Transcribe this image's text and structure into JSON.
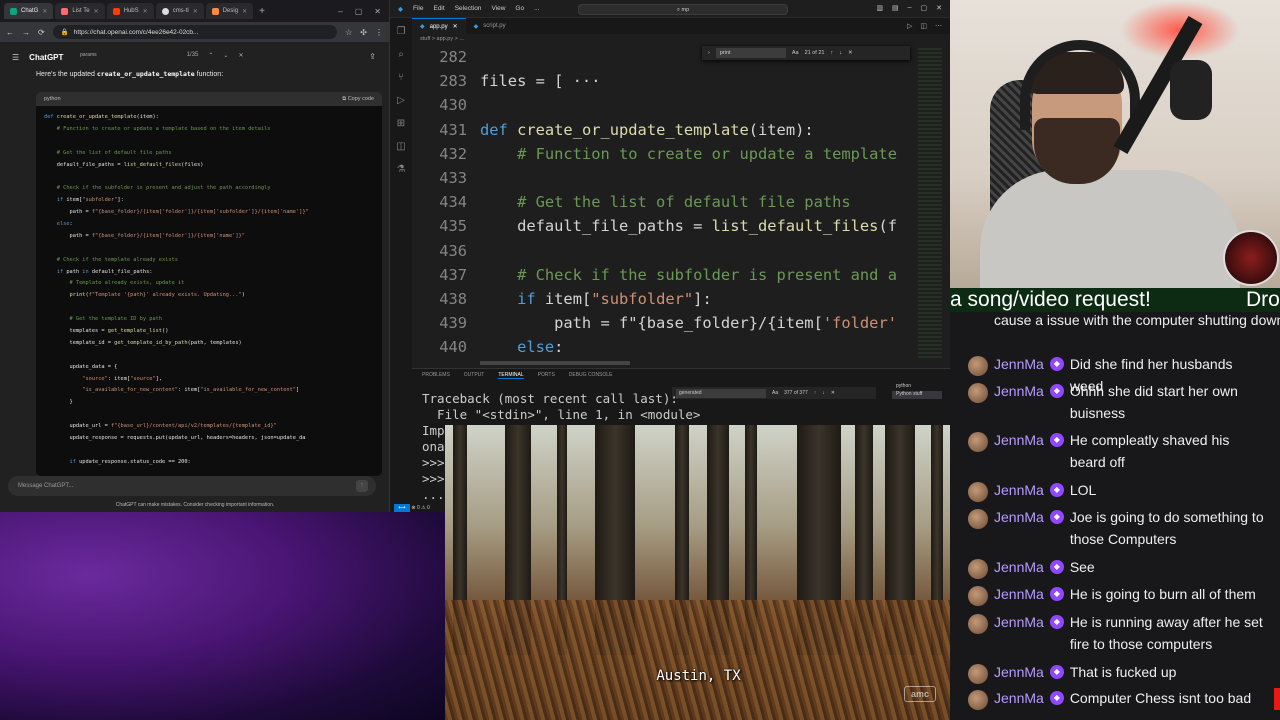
{
  "browser": {
    "tabs": [
      {
        "label": "ChatG"
      },
      {
        "label": "List Te"
      },
      {
        "label": "HubS"
      },
      {
        "label": "cms-tl"
      },
      {
        "label": "Desig"
      }
    ],
    "url": "https://chat.openai.com/c/4ee26e42-02cb...",
    "find_text": "params",
    "find_count": "1/35",
    "chatgpt": {
      "title": "ChatGPT",
      "intro_prefix": "Here's the updated",
      "intro_code": "create_or_update_template",
      "intro_suffix": "function:",
      "code_lang": "python",
      "copy_label": "Copy code",
      "code_lines": [
        "def create_or_update_template(item):",
        "    # Function to create or update a template based on the item details",
        "",
        "    # Get the list of default file paths",
        "    default_file_paths = list_default_files(files)",
        "",
        "    # Check if the subfolder is present and adjust the path accordingly",
        "    if item[\"subfolder\"]:",
        "        path = f\"{base_folder}/{item['folder']}/{item['subfolder']}/{item['name']}\"",
        "    else:",
        "        path = f\"{base_folder}/{item['folder']}/{item['name']}\"",
        "",
        "    # Check if the template already exists",
        "    if path in default_file_paths:",
        "        # Template already exists, update it",
        "        print(f\"Template '{path}' already exists. Updating...\")",
        "",
        "        # Get the template ID by path",
        "        templates = get_template_list()",
        "        template_id = get_template_id_by_path(path, templates)",
        "",
        "        update_data = {",
        "            \"source\": item[\"source\"],",
        "            \"is_available_for_new_content\": item[\"is_available_for_new_content\"]",
        "        }",
        "",
        "        update_url = f\"{base_url}/content/api/v2/templates/{template_id}\"",
        "        update_response = requests.put(update_url, headers=headers, json=update_da",
        "",
        "        if update_response.status_code == 200:"
      ],
      "input_placeholder": "Message ChatGPT...",
      "disclaimer": "ChatGPT can make mistakes. Consider checking important information."
    }
  },
  "vscode": {
    "menu": [
      "File",
      "Edit",
      "Selection",
      "View",
      "Go",
      "..."
    ],
    "search": "mp",
    "tabs": [
      {
        "label": "app.py"
      },
      {
        "label": "script.py"
      }
    ],
    "breadcrumb": "stuff > app.py > ...",
    "find": {
      "text": "print",
      "count": "21 of 21"
    },
    "editor_lines": [
      {
        "num": "282",
        "code": ""
      },
      {
        "num": "283",
        "code": "files = [ ···"
      },
      {
        "num": "430",
        "code": ""
      },
      {
        "num": "431",
        "code": "def create_or_update_template(item):"
      },
      {
        "num": "432",
        "code": "    # Function to create or update a template"
      },
      {
        "num": "433",
        "code": ""
      },
      {
        "num": "434",
        "code": "    # Get the list of default file paths"
      },
      {
        "num": "435",
        "code": "    default_file_paths = list_default_files(f"
      },
      {
        "num": "436",
        "code": ""
      },
      {
        "num": "437",
        "code": "    # Check if the subfolder is present and a"
      },
      {
        "num": "438",
        "code": "    if item[\"subfolder\"]:"
      },
      {
        "num": "439",
        "code": "        path = f\"{base_folder}/{item['folder'"
      },
      {
        "num": "440",
        "code": "    else:"
      }
    ],
    "panel_tabs": [
      "PROBLEMS",
      "OUTPUT",
      "TERMINAL",
      "PORTS",
      "DEBUG CONSOLE"
    ],
    "panel_find": {
      "text": "generated",
      "count": "377 of 377"
    },
    "terminals": [
      "python",
      "Python stuff"
    ],
    "terminal_lines": [
      "Traceback (most recent call last):",
      "  File \"<stdin>\", line 1, in <module>",
      "Imp",
      "ona",
      ">>>",
      ">>>",
      "..."
    ]
  },
  "video": {
    "subtitle": "Austin, TX",
    "network_logo": "amc"
  },
  "ticker": {
    "text": "a song/video request!",
    "text2": "Dro"
  },
  "chat": {
    "messages": [
      {
        "user": "",
        "text": "cause a issue with the computer shutting down"
      },
      {
        "user": "JennMa",
        "text": "Did she find her husbands weed"
      },
      {
        "user": "JennMa",
        "text": "Ohhh she did start her own buisness"
      },
      {
        "user": "JennMa",
        "text": "He compleatly shaved his beard off"
      },
      {
        "user": "JennMa",
        "text": "LOL"
      },
      {
        "user": "JennMa",
        "text": "Joe is going to do something to those Computers"
      },
      {
        "user": "JennMa",
        "text": "See"
      },
      {
        "user": "JennMa",
        "text": "He is going to burn all of them"
      },
      {
        "user": "JennMa",
        "text": "He is running away after he set fire to those computers"
      },
      {
        "user": "JennMa",
        "text": "That is fucked up"
      },
      {
        "user": "JennMa",
        "text": "Computer Chess isnt too bad"
      }
    ]
  }
}
